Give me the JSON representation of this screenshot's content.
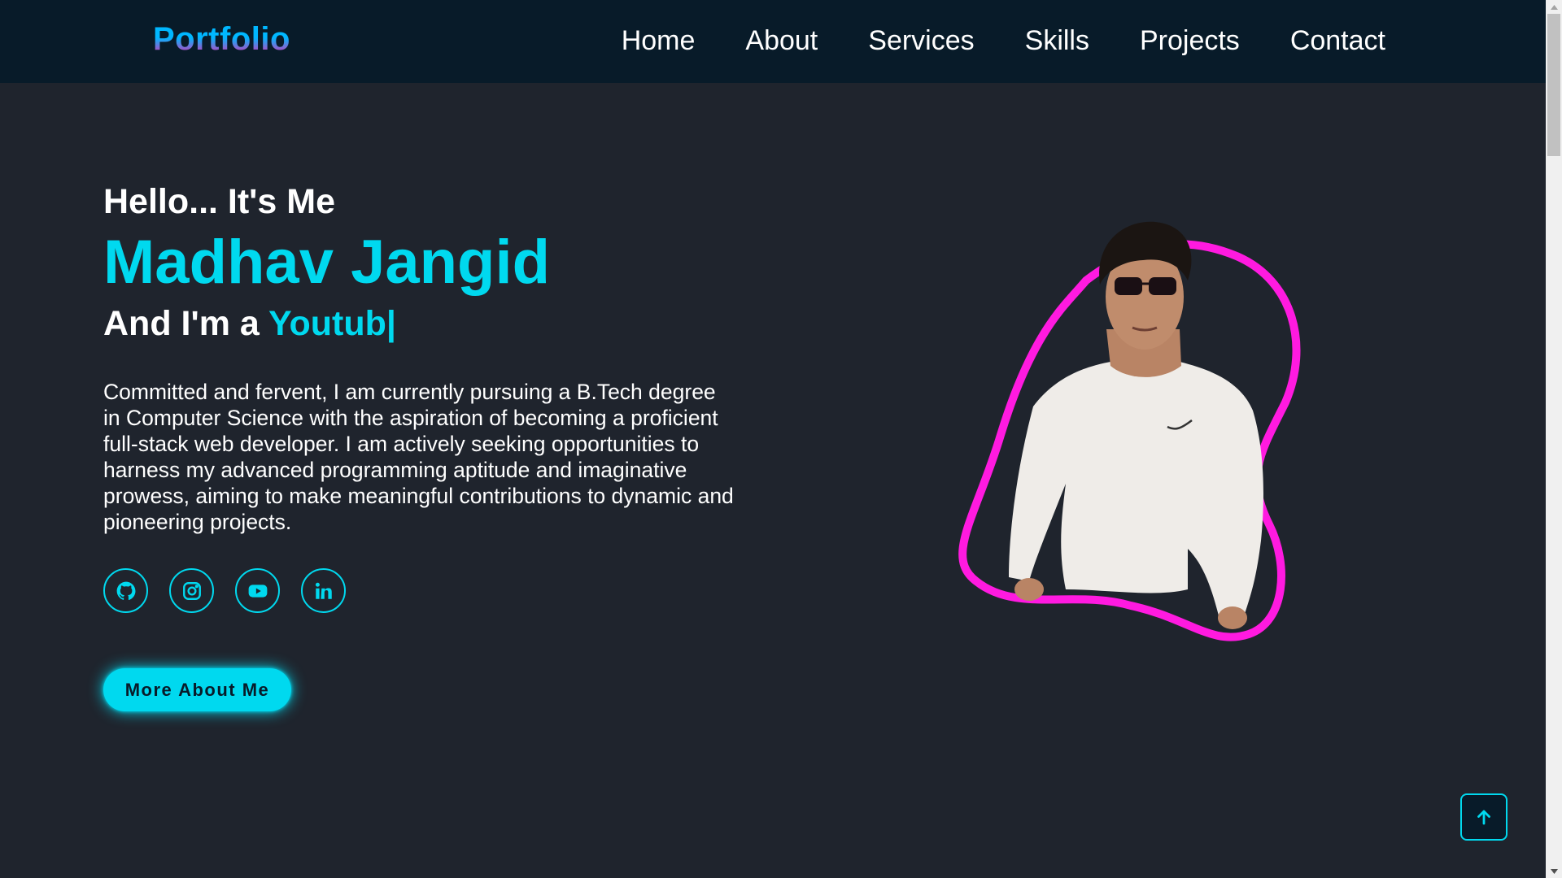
{
  "header": {
    "logo": "Portfolio",
    "nav": [
      "Home",
      "About",
      "Services",
      "Skills",
      "Projects",
      "Contact"
    ]
  },
  "hero": {
    "greeting": "Hello... It's Me",
    "name": "Madhav Jangid",
    "role_prefix": "And I'm a ",
    "role_typed": "Youtub|",
    "bio": "Committed and fervent, I am currently pursuing a B.Tech degree in Computer Science with the aspiration of becoming a proficient full-stack web developer. I am actively seeking opportunities to harness my advanced programming aptitude and imaginative prowess, aiming to make meaningful contributions to dynamic and pioneering projects.",
    "socials": [
      "github-icon",
      "instagram-icon",
      "youtube-icon",
      "linkedin-icon"
    ],
    "cta": "More About Me"
  },
  "colors": {
    "background": "#1f242d",
    "header": "#081b29",
    "accent": "#00d9ef",
    "blob": "#ff1ae0"
  }
}
